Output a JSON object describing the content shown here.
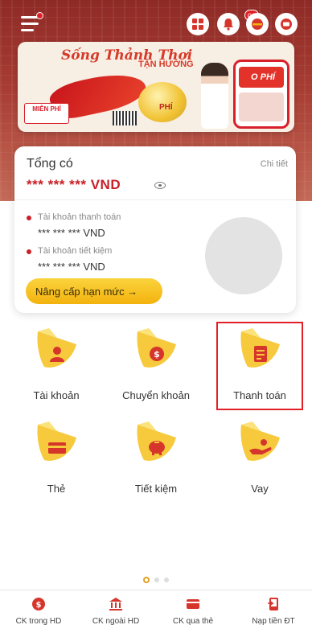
{
  "header": {
    "notification_count": "01"
  },
  "banner": {
    "title": "Sống Thảnh Thơi",
    "subtitle": "TẬN HƯỞNG",
    "coin_label": "PHÍ",
    "mien_phi": "MIỄN PHÍ",
    "phone_logo": "O PHÍ"
  },
  "balance_card": {
    "title": "Tổng có",
    "detail_link": "Chi tiết",
    "total": "*** *** *** VND",
    "accounts": [
      {
        "name": "Tài khoản thanh toán",
        "value": "*** *** *** VND",
        "color": "#c92027"
      },
      {
        "name": "Tài khoản tiết kiệm",
        "value": "*** *** *** VND",
        "color": "#c92027"
      }
    ],
    "upgrade_button": "Nâng cấp hạn mức  →",
    "pie_color": "#e3e3e3"
  },
  "menu": [
    {
      "label": "Tài khoản",
      "icon": "account-icon"
    },
    {
      "label": "Chuyển khoản",
      "icon": "transfer-icon"
    },
    {
      "label": "Thanh toán",
      "icon": "payment-icon"
    },
    {
      "label": "Thẻ",
      "icon": "card-icon"
    },
    {
      "label": "Tiết kiệm",
      "icon": "savings-icon"
    },
    {
      "label": "Vay",
      "icon": "loan-icon"
    }
  ],
  "pager": {
    "pages": 3,
    "active": 1
  },
  "bottom_nav": [
    {
      "label": "CK trong HD",
      "icon": "transfer-internal-icon"
    },
    {
      "label": "CK ngoài HD",
      "icon": "bank-icon"
    },
    {
      "label": "CK qua thẻ",
      "icon": "card-transfer-icon"
    },
    {
      "label": "Nạp tiền ĐT",
      "icon": "phone-topup-icon"
    }
  ],
  "colors": {
    "brand_red": "#c92027",
    "accent_yellow": "#f3b30e",
    "highlight": "#e21f26"
  }
}
